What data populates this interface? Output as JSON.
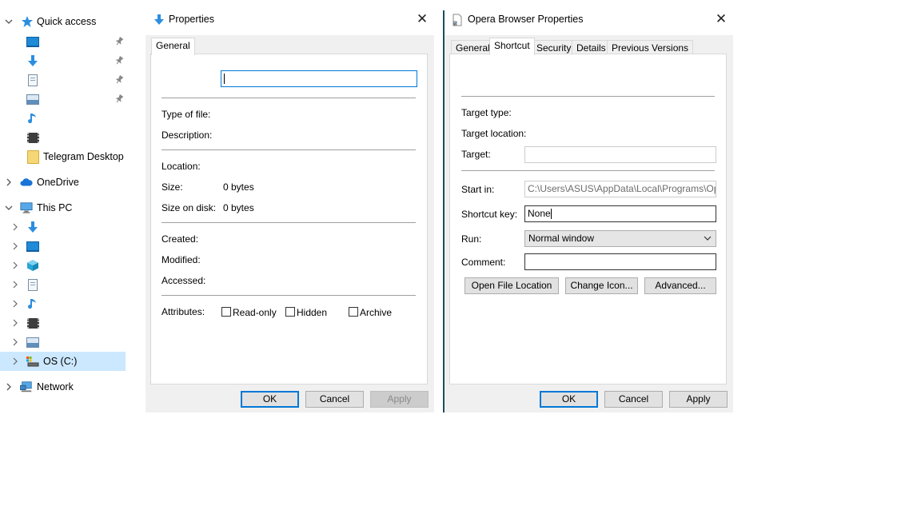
{
  "sidebar": {
    "quick_access": "Quick access",
    "quick_items": [
      {
        "icon": "desktop-icon"
      },
      {
        "icon": "downloads-icon"
      },
      {
        "icon": "documents-icon"
      },
      {
        "icon": "pictures-icon"
      },
      {
        "icon": "music-icon"
      },
      {
        "icon": "videos-icon"
      },
      {
        "icon": "folder-icon",
        "label": "Telegram Desktop"
      }
    ],
    "onedrive": "OneDrive",
    "this_pc": "This PC",
    "os_drive": "OS (C:)",
    "network": "Network"
  },
  "props_dialog": {
    "title": "Properties",
    "tab_general": "General",
    "type_of_file": "Type of file:",
    "description": "Description:",
    "location": "Location:",
    "size": "Size:",
    "size_value": "0 bytes",
    "size_on_disk": "Size on disk:",
    "size_on_disk_value": "0 bytes",
    "created": "Created:",
    "modified": "Modified:",
    "accessed": "Accessed:",
    "attributes": "Attributes:",
    "read_only": "Read-only",
    "hidden": "Hidden",
    "archive": "Archive",
    "ok": "OK",
    "cancel": "Cancel",
    "apply": "Apply"
  },
  "opera_dialog": {
    "title": "Opera Browser Properties",
    "tabs": [
      "General",
      "Shortcut",
      "Security",
      "Details",
      "Previous Versions"
    ],
    "target_type": "Target type:",
    "target_location": "Target location:",
    "target": "Target:",
    "start_in": "Start in:",
    "start_in_value": "C:\\Users\\ASUS\\AppData\\Local\\Programs\\Opera",
    "shortcut_key": "Shortcut key:",
    "shortcut_key_value": "None",
    "run": "Run:",
    "run_value": "Normal window",
    "comment": "Comment:",
    "open_file_location": "Open File Location",
    "change_icon": "Change Icon...",
    "advanced": "Advanced...",
    "ok": "OK",
    "cancel": "Cancel",
    "apply": "Apply"
  },
  "colors": {
    "accent": "#0078d7",
    "selection": "#cce8ff",
    "dialog_bg": "#f0f0f0"
  }
}
